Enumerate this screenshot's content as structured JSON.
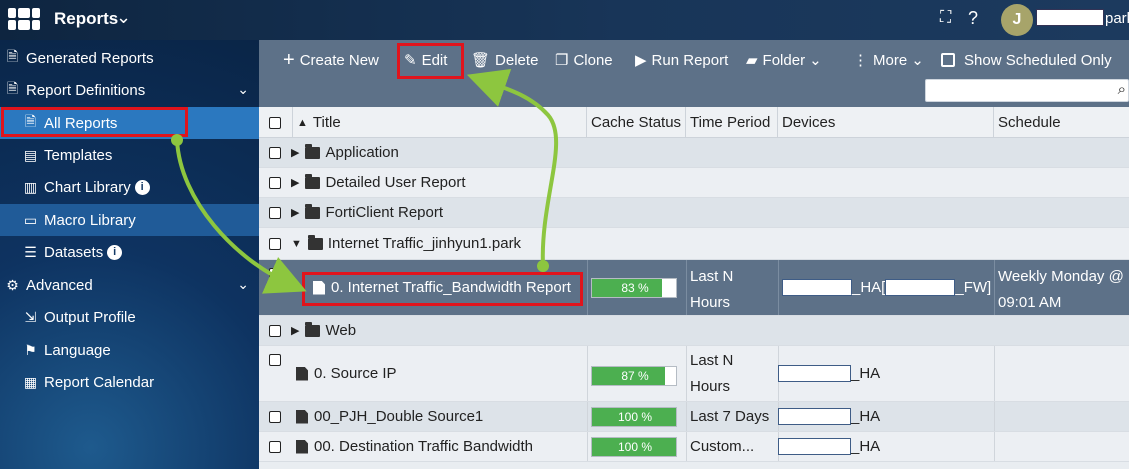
{
  "header": {
    "app_title": "Reports",
    "avatar_initial": "J",
    "username_suffix": "park"
  },
  "sidebar": {
    "groups": [
      {
        "label": "Generated Reports"
      },
      {
        "label": "Report Definitions"
      },
      {
        "label": "Advanced"
      }
    ],
    "items": [
      {
        "label": "All Reports"
      },
      {
        "label": "Templates"
      },
      {
        "label": "Chart Library"
      },
      {
        "label": "Macro Library"
      },
      {
        "label": "Datasets"
      },
      {
        "label": "Output Profile"
      },
      {
        "label": "Language"
      },
      {
        "label": "Report Calendar"
      }
    ]
  },
  "toolbar": {
    "create_new": "Create New",
    "edit": "Edit",
    "delete": "Delete",
    "clone": "Clone",
    "run_report": "Run Report",
    "folder": "Folder",
    "more": "More",
    "show_scheduled": "Show Scheduled Only",
    "search_placeholder": ""
  },
  "table": {
    "columns": [
      "Title",
      "Cache Status",
      "Time Period",
      "Devices",
      "Schedule"
    ],
    "rows": [
      {
        "type": "folder",
        "title": "Application"
      },
      {
        "type": "folder",
        "title": "Detailed User Report"
      },
      {
        "type": "folder",
        "title": "FortiClient Report"
      },
      {
        "type": "folder",
        "title": "Internet Traffic_jinhyun1.park",
        "expanded": true
      },
      {
        "type": "report",
        "title": "0. Internet Traffic_Bandwidth Report",
        "cache": "83 %",
        "cache_pct": 83,
        "time_period_1": "Last N",
        "time_period_2": "Hours",
        "device_a": "_HA[",
        "device_b": "_FW]",
        "schedule_1": "Weekly Monday @",
        "schedule_2": "09:01 AM",
        "selected": true
      },
      {
        "type": "folder",
        "title": "Web"
      },
      {
        "type": "report",
        "title": "0. Source IP",
        "cache": "87 %",
        "cache_pct": 87,
        "time_period_1": "Last N",
        "time_period_2": "Hours",
        "device": "_HA"
      },
      {
        "type": "report",
        "title": "00_PJH_Double Source1",
        "cache": "100 %",
        "cache_pct": 100,
        "time_period": "Last 7 Days",
        "device": "_HA"
      },
      {
        "type": "report",
        "title": "00. Destination Traffic Bandwidth",
        "cache": "100 %",
        "cache_pct": 100,
        "time_period": "Custom...",
        "device": "_HA"
      }
    ]
  },
  "colors": {
    "accent": "#2b78bf",
    "header_bg": "#0e2540",
    "toolbar_bg": "#5d7188",
    "progress": "#4caf50",
    "highlight": "#e0141c",
    "annotation": "#8dc63f"
  },
  "icons": [
    "fortinet-logo-icon",
    "fullscreen-icon",
    "help-icon",
    "chevron-down-icon",
    "plus-icon",
    "edit-icon",
    "trash-icon",
    "clone-icon",
    "play-circle-icon",
    "folder-icon",
    "more-icon",
    "search-icon",
    "document-icon",
    "info-icon",
    "gear-icon",
    "flag-icon",
    "calendar-icon"
  ]
}
